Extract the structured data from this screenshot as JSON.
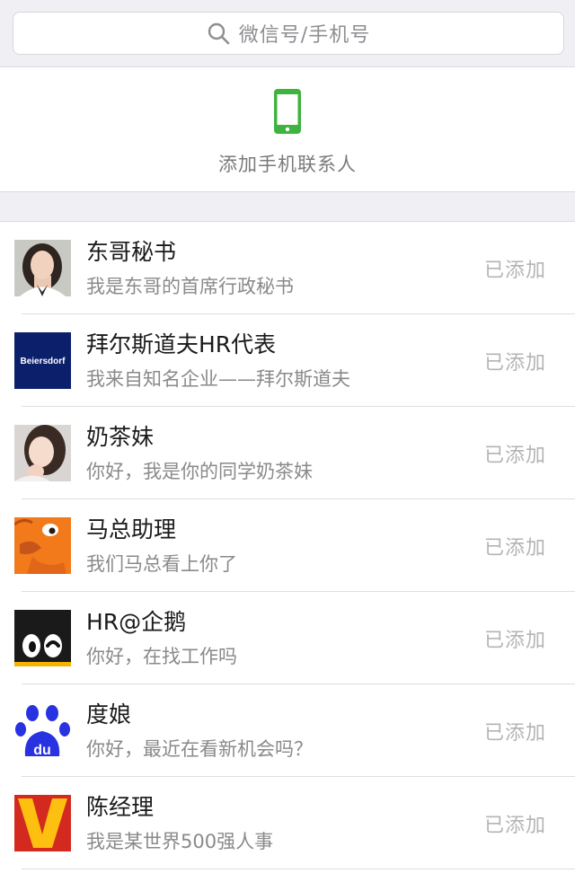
{
  "search": {
    "placeholder": "微信号/手机号"
  },
  "phone_contacts": {
    "label": "添加手机联系人"
  },
  "contacts": [
    {
      "name": "东哥秘书",
      "desc": "我是东哥的首席行政秘书",
      "status": "已添加"
    },
    {
      "name": "拜尔斯道夫HR代表",
      "desc": "我来自知名企业——拜尔斯道夫",
      "status": "已添加",
      "avatar_logo_text": "Beiersdorf"
    },
    {
      "name": "奶茶妹",
      "desc": "你好，我是你的同学奶茶妹",
      "status": "已添加"
    },
    {
      "name": "马总助理",
      "desc": "我们马总看上你了",
      "status": "已添加"
    },
    {
      "name": "HR@企鹅",
      "desc": "你好，在找工作吗",
      "status": "已添加"
    },
    {
      "name": "度娘",
      "desc": "你好，最近在看新机会吗？",
      "status": "已添加"
    },
    {
      "name": "陈经理",
      "desc": "我是某世界500强人事",
      "status": "已添加"
    }
  ],
  "colors": {
    "accent_green": "#3fb33f",
    "background_gray": "#efeff4",
    "status_gray": "#b4b4b4"
  },
  "icons": {
    "search": "search-icon",
    "phone": "mobile-phone-icon"
  }
}
